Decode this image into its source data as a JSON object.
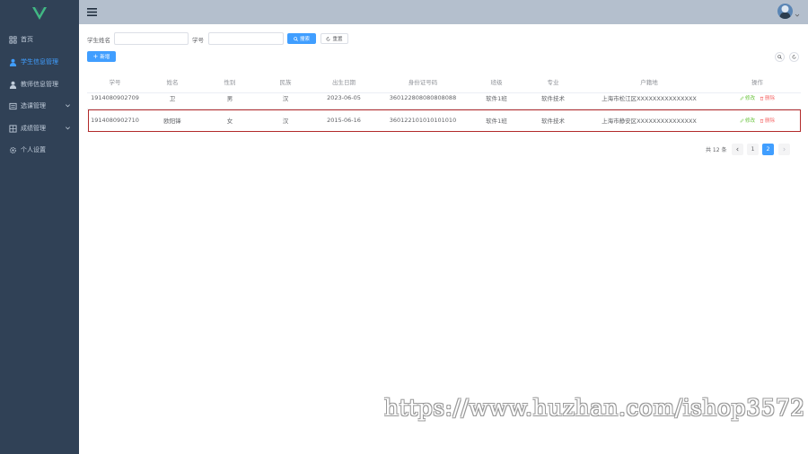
{
  "sidebar": {
    "items": [
      {
        "label": "首页",
        "icon": "dashboard-icon",
        "active": false,
        "has_arrow": false
      },
      {
        "label": "学生信息管理",
        "icon": "user-icon",
        "active": true,
        "has_arrow": false
      },
      {
        "label": "教师信息管理",
        "icon": "teacher-icon",
        "active": false,
        "has_arrow": false
      },
      {
        "label": "选课管理",
        "icon": "list-icon",
        "active": false,
        "has_arrow": true
      },
      {
        "label": "成绩管理",
        "icon": "grade-icon",
        "active": false,
        "has_arrow": true
      },
      {
        "label": "个人设置",
        "icon": "gear-icon",
        "active": false,
        "has_arrow": false
      }
    ]
  },
  "search": {
    "name_label": "学生姓名",
    "name_value": "",
    "id_label": "学号",
    "id_value": "",
    "search_button": "搜索",
    "reset_button": "重置"
  },
  "toolbar": {
    "add_button": "新增"
  },
  "table": {
    "columns": [
      "学号",
      "姓名",
      "性别",
      "民族",
      "出生日期",
      "身份证号码",
      "班级",
      "专业",
      "户籍地",
      "操作"
    ],
    "rows": [
      [
        "1914080902709",
        "卫",
        "男",
        "汉",
        "2023-06-05",
        "360122808080808088",
        "软件1班",
        "软件技术",
        "上海市松江区XXXXXXXXXXXXXXX"
      ],
      [
        "1914080902710",
        "欧阳锋",
        "女",
        "汉",
        "2015-06-16",
        "360122101010101010",
        "软件1班",
        "软件技术",
        "上海市静安区XXXXXXXXXXXXXXX"
      ]
    ],
    "edit_label": "修改",
    "delete_label": "删除"
  },
  "pagination": {
    "total_text": "共 12 条",
    "pages": [
      "1",
      "2"
    ],
    "current": "2"
  },
  "watermark": "https://www.huzhan.com/ishop3572",
  "colors": {
    "sidebar_bg": "#304156",
    "header_bg": "#b4bfcd",
    "primary": "#409eff",
    "success": "#67c23a",
    "danger": "#f56c6c",
    "highlight_border": "#b22a2a"
  }
}
